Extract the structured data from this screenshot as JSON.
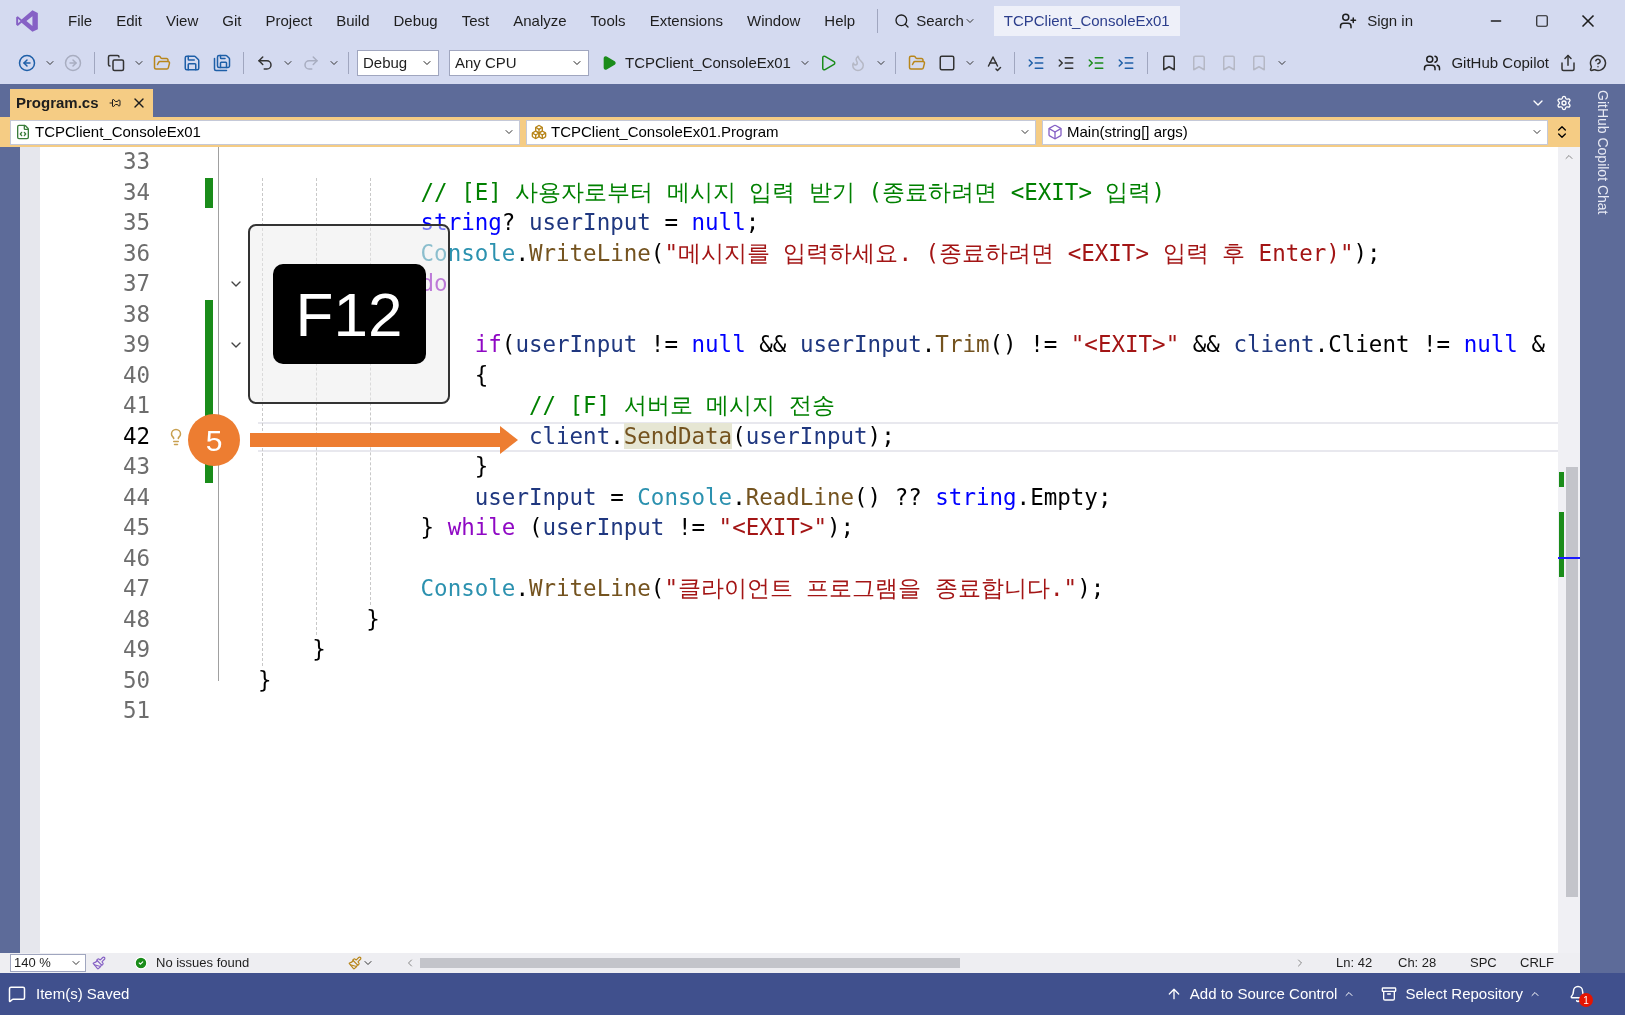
{
  "title_bar": {
    "menus": [
      "File",
      "Edit",
      "View",
      "Git",
      "Project",
      "Build",
      "Debug",
      "Test",
      "Analyze",
      "Tools",
      "Extensions",
      "Window",
      "Help"
    ],
    "search": "Search",
    "solution": "TCPClient_ConsoleEx01",
    "sign_in": "Sign in"
  },
  "toolbar": {
    "configuration": "Debug",
    "platform": "Any CPU",
    "startup": "TCPClient_ConsoleEx01",
    "copilot": "GitHub Copilot"
  },
  "document_tabs": [
    {
      "label": "Program.cs",
      "selected": true
    }
  ],
  "navigation_bar": {
    "project": "TCPClient_ConsoleEx01",
    "type": "TCPClient_ConsoleEx01.Program",
    "member": "Main(string[] args)"
  },
  "editor": {
    "lines": [
      {
        "number": "33",
        "current": false,
        "changed": false,
        "fold": false
      },
      {
        "number": "34",
        "current": false,
        "changed": true,
        "fold": false,
        "tokens": [
          {
            "kind": "comment",
            "text": "            // [E] 사용자로부터 메시지 입력 받기 (종료하려면 <EXIT> 입력)"
          }
        ]
      },
      {
        "number": "35",
        "current": false,
        "changed": false,
        "fold": false,
        "tokens": [
          {
            "kind": "keyword",
            "text": "            string"
          },
          {
            "kind": "plain",
            "text": "? "
          },
          {
            "kind": "variable",
            "text": "userInput"
          },
          {
            "kind": "plain",
            "text": " = "
          },
          {
            "kind": "keyword",
            "text": "null"
          },
          {
            "kind": "plain",
            "text": ";"
          }
        ]
      },
      {
        "number": "36",
        "current": false,
        "changed": false,
        "fold": false,
        "tokens": [
          {
            "kind": "type",
            "text": "            Console"
          },
          {
            "kind": "plain",
            "text": "."
          },
          {
            "kind": "method",
            "text": "WriteLine"
          },
          {
            "kind": "plain",
            "text": "("
          },
          {
            "kind": "string",
            "text": "\"메시지를 입력하세요. (종료하려면 <EXIT> 입력 후 Enter)\""
          },
          {
            "kind": "plain",
            "text": ");"
          }
        ]
      },
      {
        "number": "37",
        "current": false,
        "changed": false,
        "fold": true,
        "tokens": [
          {
            "kind": "control",
            "text": "            do"
          }
        ]
      },
      {
        "number": "38",
        "current": false,
        "changed": true,
        "fold": false
      },
      {
        "number": "39",
        "current": false,
        "changed": true,
        "fold": true,
        "tokens": [
          {
            "kind": "control",
            "text": "                if"
          },
          {
            "kind": "plain",
            "text": "("
          },
          {
            "kind": "variable",
            "text": "userInput"
          },
          {
            "kind": "plain",
            "text": " != "
          },
          {
            "kind": "keyword",
            "text": "null"
          },
          {
            "kind": "plain",
            "text": " && "
          },
          {
            "kind": "variable",
            "text": "userInput"
          },
          {
            "kind": "plain",
            "text": "."
          },
          {
            "kind": "method",
            "text": "Trim"
          },
          {
            "kind": "plain",
            "text": "() != "
          },
          {
            "kind": "string",
            "text": "\"<EXIT>\""
          },
          {
            "kind": "plain",
            "text": " && "
          },
          {
            "kind": "variable",
            "text": "client"
          },
          {
            "kind": "plain",
            "text": ".Client != "
          },
          {
            "kind": "keyword",
            "text": "null"
          },
          {
            "kind": "plain",
            "text": " &"
          }
        ]
      },
      {
        "number": "40",
        "current": false,
        "changed": true,
        "fold": false,
        "tokens": [
          {
            "kind": "plain",
            "text": "                {"
          }
        ]
      },
      {
        "number": "41",
        "current": false,
        "changed": true,
        "fold": false,
        "tokens": [
          {
            "kind": "comment",
            "text": "                    // [F] 서버로 메시지 전송"
          }
        ]
      },
      {
        "number": "42",
        "current": true,
        "changed": false,
        "fold": false,
        "tokens": [
          {
            "kind": "variable",
            "text": "                    client"
          },
          {
            "kind": "plain",
            "text": "."
          },
          {
            "kind": "reference",
            "text": "SendData"
          },
          {
            "kind": "plain",
            "text": "("
          },
          {
            "kind": "variable",
            "text": "userInput"
          },
          {
            "kind": "plain",
            "text": ");"
          }
        ]
      },
      {
        "number": "43",
        "current": false,
        "changed": true,
        "fold": false,
        "tokens": [
          {
            "kind": "plain",
            "text": "                }"
          }
        ]
      },
      {
        "number": "44",
        "current": false,
        "changed": false,
        "fold": false,
        "tokens": [
          {
            "kind": "variable",
            "text": "                userInput"
          },
          {
            "kind": "plain",
            "text": " = "
          },
          {
            "kind": "type",
            "text": "Console"
          },
          {
            "kind": "plain",
            "text": "."
          },
          {
            "kind": "method",
            "text": "ReadLine"
          },
          {
            "kind": "plain",
            "text": "() ?? "
          },
          {
            "kind": "keyword",
            "text": "string"
          },
          {
            "kind": "plain",
            "text": ".Empty;"
          }
        ]
      },
      {
        "number": "45",
        "current": false,
        "changed": false,
        "fold": false,
        "tokens": [
          {
            "kind": "plain",
            "text": "            } "
          },
          {
            "kind": "control",
            "text": "while"
          },
          {
            "kind": "plain",
            "text": " ("
          },
          {
            "kind": "variable",
            "text": "userInput"
          },
          {
            "kind": "plain",
            "text": " != "
          },
          {
            "kind": "string",
            "text": "\"<EXIT>\""
          },
          {
            "kind": "plain",
            "text": ");"
          }
        ]
      },
      {
        "number": "46",
        "current": false,
        "changed": false,
        "fold": false
      },
      {
        "number": "47",
        "current": false,
        "changed": false,
        "fold": false,
        "tokens": [
          {
            "kind": "type",
            "text": "            Console"
          },
          {
            "kind": "plain",
            "text": "."
          },
          {
            "kind": "method",
            "text": "WriteLine"
          },
          {
            "kind": "plain",
            "text": "("
          },
          {
            "kind": "string",
            "text": "\"클라이언트 프로그램을 종료합니다.\""
          },
          {
            "kind": "plain",
            "text": ");"
          }
        ]
      },
      {
        "number": "48",
        "current": false,
        "changed": false,
        "fold": false,
        "tokens": [
          {
            "kind": "plain",
            "text": "        }"
          }
        ]
      },
      {
        "number": "49",
        "current": false,
        "changed": false,
        "fold": false,
        "tokens": [
          {
            "kind": "plain",
            "text": "    }"
          }
        ]
      },
      {
        "number": "50",
        "current": false,
        "changed": false,
        "fold": false,
        "tokens": [
          {
            "kind": "plain",
            "text": "}"
          }
        ]
      },
      {
        "number": "51",
        "current": false,
        "changed": false,
        "fold": false
      }
    ]
  },
  "overlay": {
    "key": "F12",
    "step": "5"
  },
  "side_panel": {
    "label": "GitHub Copilot Chat"
  },
  "editor_status": {
    "zoom": "140 %",
    "issues": "No issues found",
    "line": "Ln: 42",
    "column": "Ch: 28",
    "whitespace": "SPC",
    "line_ending": "CRLF"
  },
  "status_bar": {
    "message": "Item(s) Saved",
    "source_control": "Add to Source Control",
    "repository": "Select Repository",
    "notifications": "1"
  }
}
